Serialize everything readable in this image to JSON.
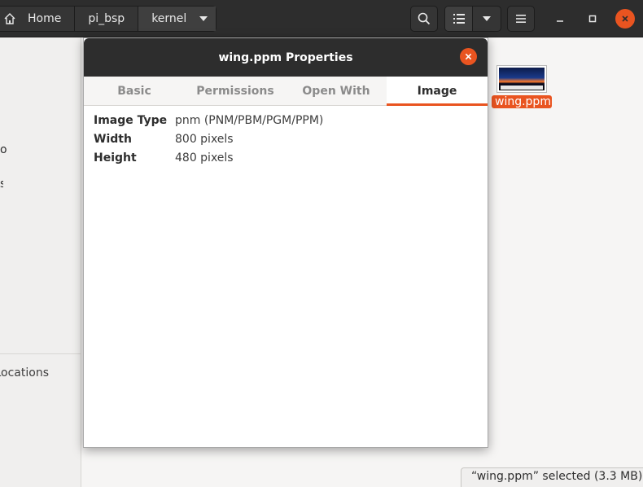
{
  "header": {
    "breadcrumbs": [
      {
        "label": "Home",
        "icon": "home-icon"
      },
      {
        "label": "pi_bsp"
      },
      {
        "label": "kernel"
      }
    ],
    "buttons": [
      "search-icon",
      "list-view-icon",
      "view-options-icon",
      "hamburger-menu-icon"
    ],
    "window_controls": [
      "minimize-icon",
      "maximize-icon",
      "close-icon"
    ],
    "accent": "#e95420"
  },
  "sidebar": {
    "fragment_1": "o",
    "fragment_2": "s",
    "other_locations": "Other Locations"
  },
  "file": {
    "name": "wing.ppm"
  },
  "status": {
    "text": "“wing.ppm” selected  (3.3 MB)"
  },
  "dialog": {
    "title": "wing.ppm Properties",
    "tabs": [
      {
        "label": "Basic",
        "active": false
      },
      {
        "label": "Permissions",
        "active": false
      },
      {
        "label": "Open With",
        "active": false
      },
      {
        "label": "Image",
        "active": true
      }
    ],
    "properties": [
      {
        "key": "Image Type",
        "value": "pnm (PNM/PBM/PGM/PPM)"
      },
      {
        "key": "Width",
        "value": "800 pixels"
      },
      {
        "key": "Height",
        "value": "480 pixels"
      }
    ]
  }
}
